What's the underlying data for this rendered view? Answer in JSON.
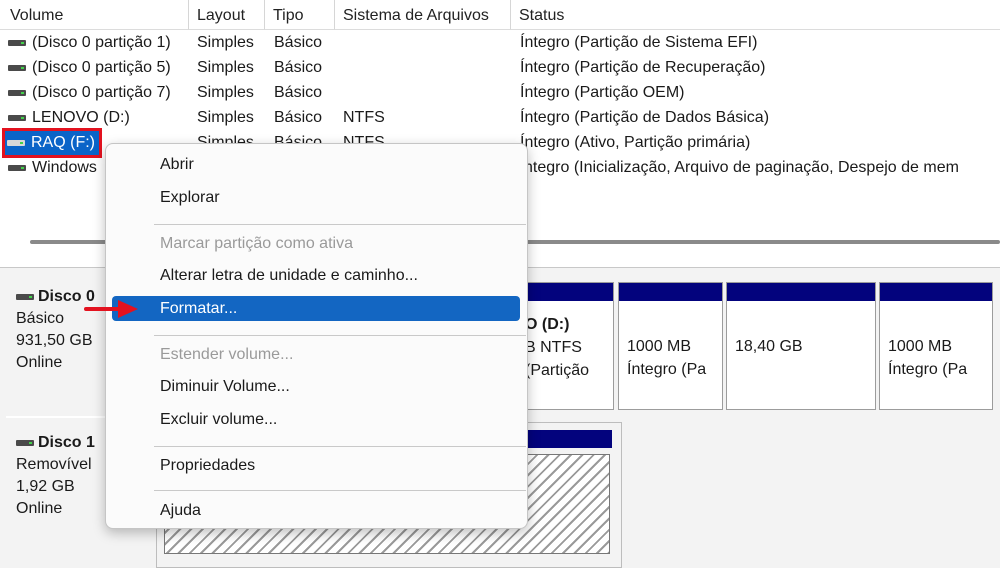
{
  "columns": [
    "Volume",
    "Layout",
    "Tipo",
    "Sistema de Arquivos",
    "Status"
  ],
  "volumes": [
    {
      "name": "(Disco 0 partição 1)",
      "layout": "Simples",
      "type": "Básico",
      "fs": "",
      "status": "Íntegro (Partição de Sistema EFI)"
    },
    {
      "name": "(Disco 0 partição 5)",
      "layout": "Simples",
      "type": "Básico",
      "fs": "",
      "status": "Íntegro (Partição de Recuperação)"
    },
    {
      "name": "(Disco 0 partição 7)",
      "layout": "Simples",
      "type": "Básico",
      "fs": "",
      "status": "Íntegro (Partição OEM)"
    },
    {
      "name": "LENOVO (D:)",
      "layout": "Simples",
      "type": "Básico",
      "fs": "NTFS",
      "status": "Íntegro (Partição de Dados Básica)"
    },
    {
      "name": "RAQ (F:)",
      "layout": "Simples",
      "type": "Básico",
      "fs": "NTFS",
      "status": "Íntegro (Ativo, Partição primária)"
    },
    {
      "name": "Windows",
      "layout": "",
      "type": "",
      "fs": "",
      "status": "ntegro (Inicialização, Arquivo de paginação, Despejo de mem"
    }
  ],
  "disks": [
    {
      "name": "Disco 0",
      "type": "Básico",
      "size": "931,50 GB",
      "state": "Online"
    },
    {
      "name": "Disco 1",
      "type": "Removível",
      "size": "1,92 GB",
      "state": "Online"
    }
  ],
  "partitions": [
    {
      "line1": "O  (D:)",
      "line2": "B NTFS",
      "line3": "(Partição"
    },
    {
      "line1": "1000 MB",
      "line2": "Íntegro (Pa",
      "line3": ""
    },
    {
      "line1": "18,40 GB",
      "line2": "",
      "line3": ""
    },
    {
      "line1": "1000 MB",
      "line2": "Íntegro (Pa",
      "line3": ""
    }
  ],
  "menu": {
    "items": [
      {
        "label": "Abrir",
        "disabled": false
      },
      {
        "label": "Explorar",
        "disabled": false
      },
      {
        "label": "Marcar partição como ativa",
        "disabled": true
      },
      {
        "label": "Alterar letra de unidade e caminho...",
        "disabled": false
      },
      {
        "label": "Formatar...",
        "disabled": false,
        "highlighted": true
      },
      {
        "label": "Estender volume...",
        "disabled": true
      },
      {
        "label": "Diminuir Volume...",
        "disabled": false
      },
      {
        "label": "Excluir volume...",
        "disabled": false
      },
      {
        "label": "Propriedades",
        "disabled": false
      },
      {
        "label": "Ajuda",
        "disabled": false
      }
    ]
  },
  "colors": {
    "accent": "#1366c2",
    "partition_bar": "#03037d",
    "annotation": "#e3121f"
  }
}
